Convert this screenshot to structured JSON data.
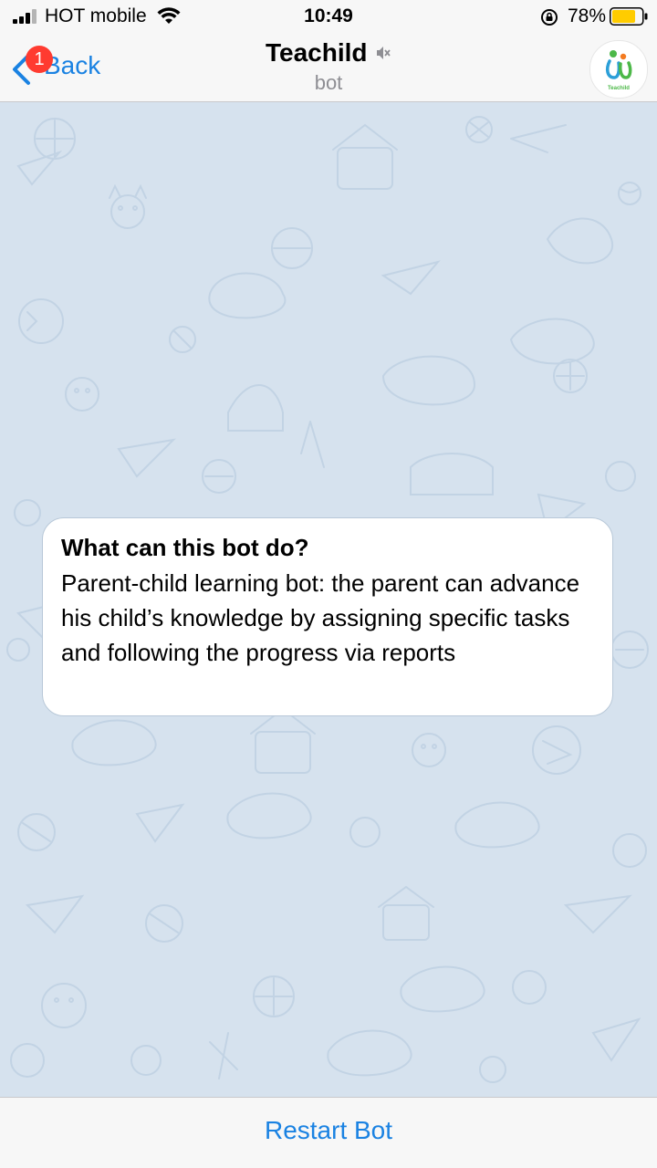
{
  "status_bar": {
    "carrier": "HOT mobile",
    "time": "10:49",
    "battery_percent": "78%",
    "battery_level": 0.78,
    "icons": [
      "signal-icon",
      "wifi-icon",
      "rotation-lock-icon",
      "battery-icon"
    ]
  },
  "nav": {
    "back_label": "Back",
    "badge_count": "1",
    "title": "Teachild",
    "subtitle": "bot",
    "avatar_text": "Teachild",
    "icons": [
      "chevron-left-icon",
      "mute-icon",
      "avatar"
    ]
  },
  "bot_info": {
    "title": "What can this bot do?",
    "description": "Parent-child learning bot: the parent can advance his child’s knowledge by assigning specific tasks and following the progress via reports"
  },
  "bottom": {
    "restart_label": "Restart Bot"
  },
  "colors": {
    "accent": "#1a82e2",
    "badge": "#ff3b30",
    "chat_background": "#d6e2ee",
    "battery_fill": "#ffcc00",
    "avatar_green": "#4cb848"
  }
}
